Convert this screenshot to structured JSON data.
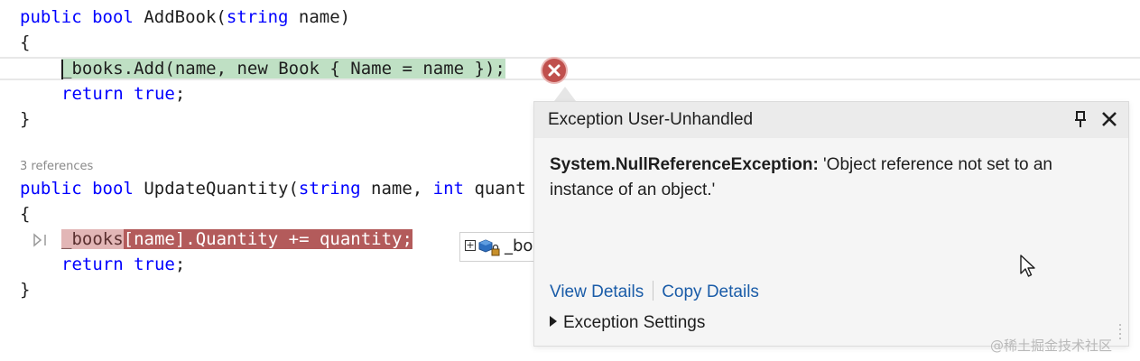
{
  "code": {
    "m1": {
      "kw_public": "public",
      "kw_bool": "bool",
      "name": "AddBook(",
      "kw_string": "string",
      "param": "name)"
    },
    "m1_open": "{",
    "m1_stmt": "_books.Add(name, new Book { Name = name });",
    "m1_return_kw": "return",
    "m1_return_true": "true",
    "m1_return_semi": ";",
    "m1_close": "}",
    "codelens": "3 references",
    "m2": {
      "kw_public": "public",
      "kw_bool": "bool",
      "name": "UpdateQuantity(",
      "kw_string": "string",
      "param_name": "name,",
      "kw_int": "int",
      "param_qty": "quant"
    },
    "m2_open": "{",
    "m2_stmt_books": "_books",
    "m2_stmt_rest": "[name].Quantity += quantity;",
    "m2_return_kw": "return",
    "m2_return_true": "true",
    "m2_return_semi": ";",
    "m2_close": "}"
  },
  "datatip": {
    "expand": "+",
    "label": "_bo"
  },
  "exception_popup": {
    "title": "Exception User-Unhandled",
    "exception_type": "System.NullReferenceException:",
    "message": "'Object reference not set to an instance of an object.'",
    "view_details": "View Details",
    "copy_details": "Copy Details",
    "exception_settings": "Exception Settings"
  },
  "watermark": "@稀土掘金技术社区",
  "colors": {
    "keyword": "#0000ff",
    "type": "#2b6fb4",
    "highlight_next_statement": "#bfe0c4",
    "highlight_exception": "#b35b5b",
    "error_icon": "#c0504d",
    "link": "#1a5ca8"
  }
}
